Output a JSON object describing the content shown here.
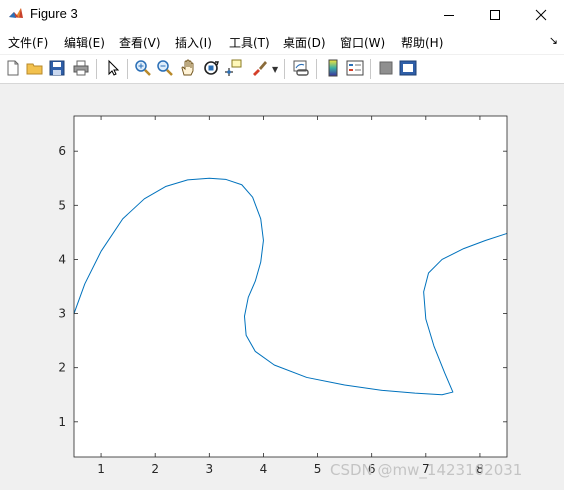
{
  "window": {
    "title": "Figure 3"
  },
  "menubar": {
    "items": [
      {
        "label": "文件(F)"
      },
      {
        "label": "编辑(E)"
      },
      {
        "label": "查看(V)"
      },
      {
        "label": "插入(I)"
      },
      {
        "label": "工具(T)"
      },
      {
        "label": "桌面(D)"
      },
      {
        "label": "窗口(W)"
      },
      {
        "label": "帮助(H)"
      }
    ],
    "overflow_icon": "dock-arrow-icon"
  },
  "toolbar": {
    "tools": [
      {
        "icon": "new-figure-icon"
      },
      {
        "icon": "open-file-icon"
      },
      {
        "icon": "save-icon"
      },
      {
        "icon": "print-icon"
      },
      {
        "icon": "edit-plot-icon"
      },
      {
        "icon": "zoom-in-icon"
      },
      {
        "icon": "zoom-out-icon"
      },
      {
        "icon": "pan-icon"
      },
      {
        "icon": "rotate-3d-icon"
      },
      {
        "icon": "data-cursor-icon"
      },
      {
        "icon": "brush-icon"
      },
      {
        "icon": "link-plot-icon"
      },
      {
        "icon": "colorbar-icon"
      },
      {
        "icon": "legend-icon"
      },
      {
        "icon": "hide-plot-tools-icon"
      },
      {
        "icon": "show-plot-tools-icon"
      }
    ]
  },
  "chart_data": {
    "type": "line",
    "title": "",
    "xlabel": "",
    "ylabel": "",
    "xlim": [
      0.5,
      8.5
    ],
    "ylim": [
      0.35,
      6.65
    ],
    "xticks": [
      "1",
      "2",
      "3",
      "4",
      "5",
      "6",
      "7",
      "8"
    ],
    "yticks": [
      "1",
      "2",
      "3",
      "4",
      "5",
      "6"
    ],
    "grid": false,
    "line_color": "#0072bd",
    "series": [
      {
        "name": "",
        "x": [
          0.5,
          0.7,
          1.0,
          1.4,
          1.8,
          2.2,
          2.6,
          3.0,
          3.3,
          3.6,
          3.8,
          3.95,
          4.0,
          3.95,
          3.85,
          3.72,
          3.65,
          3.68,
          3.85,
          4.2,
          4.8,
          5.5,
          6.2,
          6.8,
          7.3,
          7.5,
          7.35,
          7.15,
          7.0,
          6.96,
          7.05,
          7.3,
          7.7,
          8.1,
          8.5
        ],
        "y": [
          3.0,
          3.55,
          4.15,
          4.75,
          5.12,
          5.35,
          5.47,
          5.5,
          5.48,
          5.38,
          5.15,
          4.75,
          4.35,
          3.95,
          3.6,
          3.3,
          2.95,
          2.6,
          2.3,
          2.05,
          1.82,
          1.68,
          1.58,
          1.53,
          1.5,
          1.55,
          1.9,
          2.4,
          2.9,
          3.4,
          3.75,
          4.0,
          4.2,
          4.35,
          4.48
        ]
      }
    ]
  },
  "watermark": {
    "text": "CSDN @mw_1423102031"
  }
}
